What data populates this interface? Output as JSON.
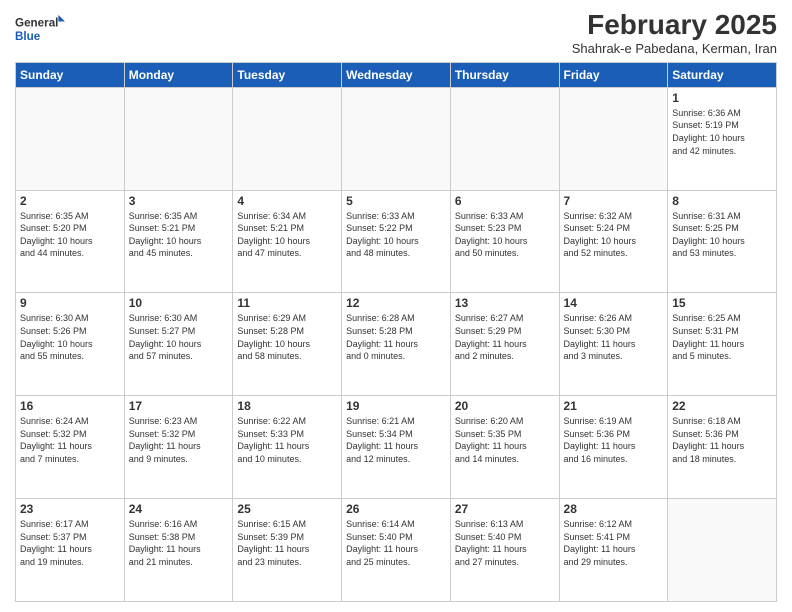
{
  "logo": {
    "line1": "General",
    "line2": "Blue"
  },
  "title": "February 2025",
  "subtitle": "Shahrak-e Pabedana, Kerman, Iran",
  "days_of_week": [
    "Sunday",
    "Monday",
    "Tuesday",
    "Wednesday",
    "Thursday",
    "Friday",
    "Saturday"
  ],
  "weeks": [
    [
      {
        "day": "",
        "info": ""
      },
      {
        "day": "",
        "info": ""
      },
      {
        "day": "",
        "info": ""
      },
      {
        "day": "",
        "info": ""
      },
      {
        "day": "",
        "info": ""
      },
      {
        "day": "",
        "info": ""
      },
      {
        "day": "1",
        "info": "Sunrise: 6:36 AM\nSunset: 5:19 PM\nDaylight: 10 hours\nand 42 minutes."
      }
    ],
    [
      {
        "day": "2",
        "info": "Sunrise: 6:35 AM\nSunset: 5:20 PM\nDaylight: 10 hours\nand 44 minutes."
      },
      {
        "day": "3",
        "info": "Sunrise: 6:35 AM\nSunset: 5:21 PM\nDaylight: 10 hours\nand 45 minutes."
      },
      {
        "day": "4",
        "info": "Sunrise: 6:34 AM\nSunset: 5:21 PM\nDaylight: 10 hours\nand 47 minutes."
      },
      {
        "day": "5",
        "info": "Sunrise: 6:33 AM\nSunset: 5:22 PM\nDaylight: 10 hours\nand 48 minutes."
      },
      {
        "day": "6",
        "info": "Sunrise: 6:33 AM\nSunset: 5:23 PM\nDaylight: 10 hours\nand 50 minutes."
      },
      {
        "day": "7",
        "info": "Sunrise: 6:32 AM\nSunset: 5:24 PM\nDaylight: 10 hours\nand 52 minutes."
      },
      {
        "day": "8",
        "info": "Sunrise: 6:31 AM\nSunset: 5:25 PM\nDaylight: 10 hours\nand 53 minutes."
      }
    ],
    [
      {
        "day": "9",
        "info": "Sunrise: 6:30 AM\nSunset: 5:26 PM\nDaylight: 10 hours\nand 55 minutes."
      },
      {
        "day": "10",
        "info": "Sunrise: 6:30 AM\nSunset: 5:27 PM\nDaylight: 10 hours\nand 57 minutes."
      },
      {
        "day": "11",
        "info": "Sunrise: 6:29 AM\nSunset: 5:28 PM\nDaylight: 10 hours\nand 58 minutes."
      },
      {
        "day": "12",
        "info": "Sunrise: 6:28 AM\nSunset: 5:28 PM\nDaylight: 11 hours\nand 0 minutes."
      },
      {
        "day": "13",
        "info": "Sunrise: 6:27 AM\nSunset: 5:29 PM\nDaylight: 11 hours\nand 2 minutes."
      },
      {
        "day": "14",
        "info": "Sunrise: 6:26 AM\nSunset: 5:30 PM\nDaylight: 11 hours\nand 3 minutes."
      },
      {
        "day": "15",
        "info": "Sunrise: 6:25 AM\nSunset: 5:31 PM\nDaylight: 11 hours\nand 5 minutes."
      }
    ],
    [
      {
        "day": "16",
        "info": "Sunrise: 6:24 AM\nSunset: 5:32 PM\nDaylight: 11 hours\nand 7 minutes."
      },
      {
        "day": "17",
        "info": "Sunrise: 6:23 AM\nSunset: 5:32 PM\nDaylight: 11 hours\nand 9 minutes."
      },
      {
        "day": "18",
        "info": "Sunrise: 6:22 AM\nSunset: 5:33 PM\nDaylight: 11 hours\nand 10 minutes."
      },
      {
        "day": "19",
        "info": "Sunrise: 6:21 AM\nSunset: 5:34 PM\nDaylight: 11 hours\nand 12 minutes."
      },
      {
        "day": "20",
        "info": "Sunrise: 6:20 AM\nSunset: 5:35 PM\nDaylight: 11 hours\nand 14 minutes."
      },
      {
        "day": "21",
        "info": "Sunrise: 6:19 AM\nSunset: 5:36 PM\nDaylight: 11 hours\nand 16 minutes."
      },
      {
        "day": "22",
        "info": "Sunrise: 6:18 AM\nSunset: 5:36 PM\nDaylight: 11 hours\nand 18 minutes."
      }
    ],
    [
      {
        "day": "23",
        "info": "Sunrise: 6:17 AM\nSunset: 5:37 PM\nDaylight: 11 hours\nand 19 minutes."
      },
      {
        "day": "24",
        "info": "Sunrise: 6:16 AM\nSunset: 5:38 PM\nDaylight: 11 hours\nand 21 minutes."
      },
      {
        "day": "25",
        "info": "Sunrise: 6:15 AM\nSunset: 5:39 PM\nDaylight: 11 hours\nand 23 minutes."
      },
      {
        "day": "26",
        "info": "Sunrise: 6:14 AM\nSunset: 5:40 PM\nDaylight: 11 hours\nand 25 minutes."
      },
      {
        "day": "27",
        "info": "Sunrise: 6:13 AM\nSunset: 5:40 PM\nDaylight: 11 hours\nand 27 minutes."
      },
      {
        "day": "28",
        "info": "Sunrise: 6:12 AM\nSunset: 5:41 PM\nDaylight: 11 hours\nand 29 minutes."
      },
      {
        "day": "",
        "info": ""
      }
    ]
  ]
}
